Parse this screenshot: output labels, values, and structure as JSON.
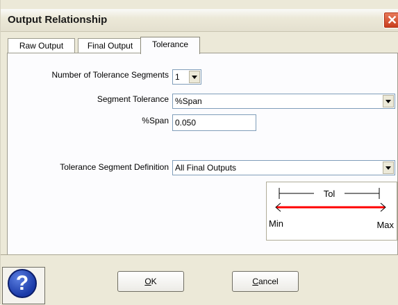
{
  "dialog": {
    "title": "Output Relationship"
  },
  "tabs": [
    {
      "label": "Raw Output"
    },
    {
      "label": "Final Output"
    },
    {
      "label": "Tolerance"
    }
  ],
  "form": {
    "num_segments_label": "Number of Tolerance Segments",
    "num_segments_value": "1",
    "segment_tolerance_label": "Segment Tolerance",
    "segment_tolerance_value": "%Span",
    "span_label": "%Span",
    "span_value": "0.050",
    "segment_definition_label": "Tolerance Segment Definition",
    "segment_definition_value": "All Final Outputs"
  },
  "diagram": {
    "tol_label": "Tol",
    "min_label": "Min",
    "max_label": "Max",
    "arrow_color": "#ff0000"
  },
  "buttons": {
    "ok_label": "OK",
    "ok_mnemonic": "O",
    "ok_rest": "K",
    "cancel_mnemonic": "C",
    "cancel_rest": "ancel"
  },
  "icons": {
    "help": "question-mark-icon",
    "close": "close-x-icon"
  }
}
